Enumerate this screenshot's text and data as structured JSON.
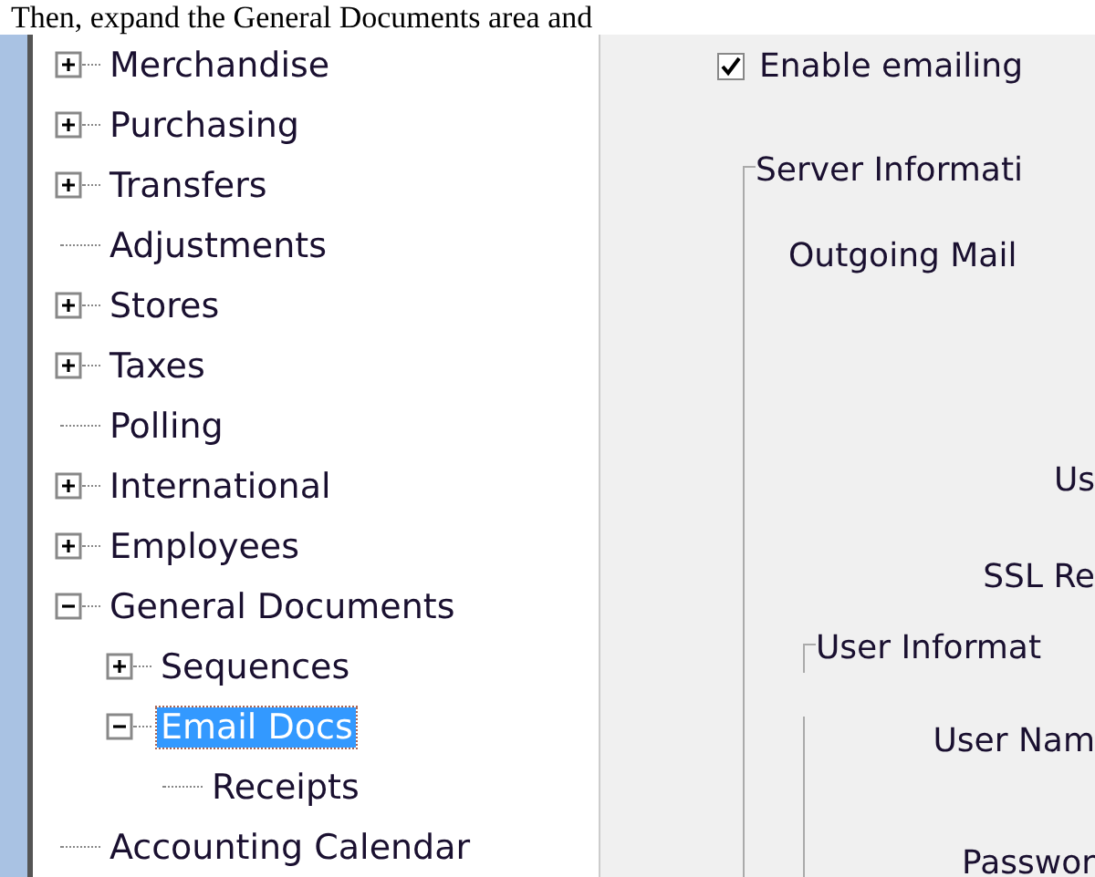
{
  "document_text": "Then, expand the General Documents area and",
  "tree": [
    {
      "label": "Merchandise",
      "kind": "branch",
      "expanded": false,
      "selected": false
    },
    {
      "label": "Purchasing",
      "kind": "branch",
      "expanded": false,
      "selected": false
    },
    {
      "label": "Transfers",
      "kind": "branch",
      "expanded": false,
      "selected": false
    },
    {
      "label": "Adjustments",
      "kind": "leaf",
      "selected": false
    },
    {
      "label": "Stores",
      "kind": "branch",
      "expanded": false,
      "selected": false
    },
    {
      "label": "Taxes",
      "kind": "branch",
      "expanded": false,
      "selected": false
    },
    {
      "label": "Polling",
      "kind": "leaf",
      "selected": false
    },
    {
      "label": "International",
      "kind": "branch",
      "expanded": false,
      "selected": false
    },
    {
      "label": "Employees",
      "kind": "branch",
      "expanded": false,
      "selected": false
    },
    {
      "label": "General Documents",
      "kind": "branch",
      "expanded": true,
      "selected": false,
      "children": [
        {
          "label": "Sequences",
          "kind": "branch",
          "expanded": false,
          "selected": false
        },
        {
          "label": "Email Docs",
          "kind": "branch",
          "expanded": true,
          "selected": true,
          "children": [
            {
              "label": "Receipts",
              "kind": "leaf",
              "selected": false
            }
          ]
        }
      ]
    },
    {
      "label": "Accounting Calendar",
      "kind": "leaf",
      "selected": false
    }
  ],
  "settings": {
    "enable_emailing": {
      "label": "Enable emailing",
      "checked": true
    },
    "server_group": {
      "title": "Server Informati",
      "labels": [
        "Outgoing Mail",
        "Us",
        "SSL Re"
      ]
    },
    "user_group": {
      "title": "User Informat",
      "labels": [
        "User Nam",
        "Passwor"
      ]
    }
  }
}
